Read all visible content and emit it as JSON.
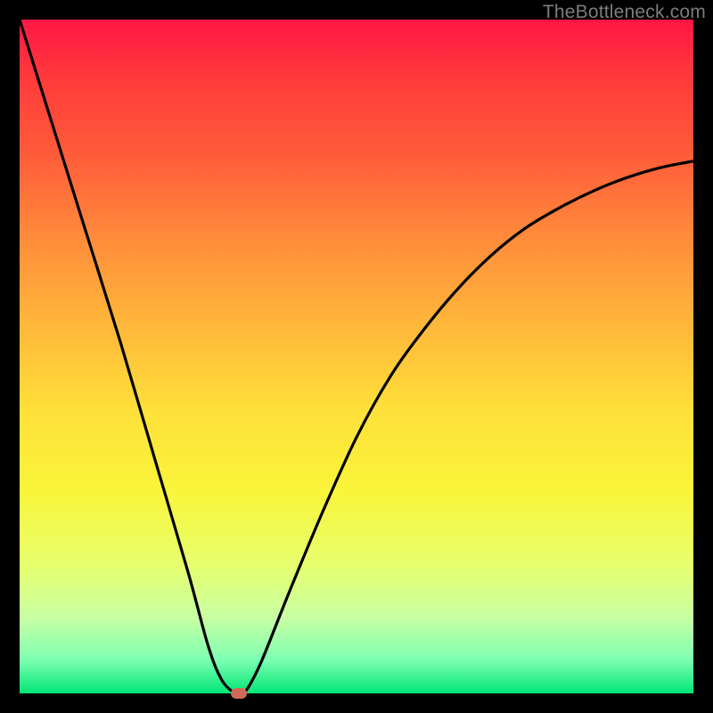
{
  "watermark": {
    "text": "TheBottleneck.com"
  },
  "chart_data": {
    "type": "line",
    "title": "",
    "xlabel": "",
    "ylabel": "",
    "xlim": [
      0,
      100
    ],
    "ylim": [
      0,
      100
    ],
    "series": [
      {
        "name": "bottleneck-curve",
        "x": [
          0,
          5,
          10,
          15,
          20,
          25,
          28,
          30,
          32,
          33,
          34,
          36,
          40,
          45,
          50,
          55,
          60,
          65,
          70,
          75,
          80,
          85,
          90,
          95,
          100
        ],
        "y": [
          100,
          84,
          68,
          52,
          35,
          18,
          7,
          2,
          0,
          0,
          1,
          5,
          15,
          27,
          38,
          47,
          54,
          60,
          65,
          69,
          72,
          74.5,
          76.5,
          78,
          79
        ]
      }
    ],
    "min_point": {
      "x": 32.5,
      "y": 0
    },
    "gradient_stops": [
      {
        "pct": 0,
        "color": "#ff1744"
      },
      {
        "pct": 50,
        "color": "#ffe03a"
      },
      {
        "pct": 100,
        "color": "#00e676"
      }
    ]
  }
}
